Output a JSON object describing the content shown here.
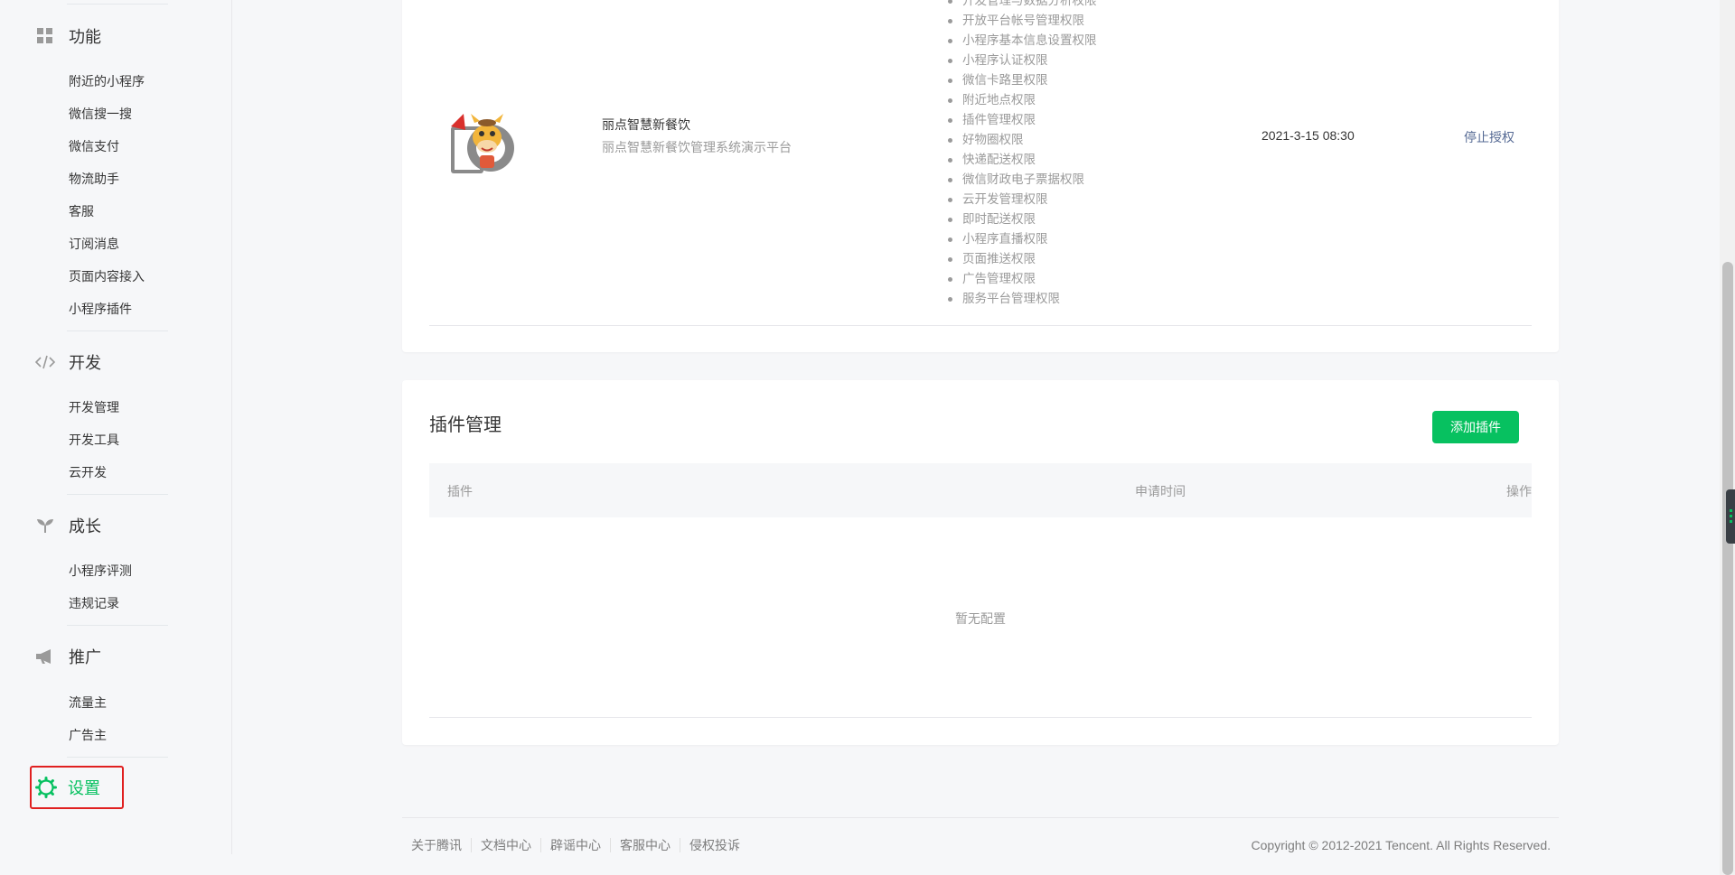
{
  "sidebar": {
    "features": {
      "title": "功能",
      "icon": "grid-icon",
      "items": [
        "附近的小程序",
        "微信搜一搜",
        "微信支付",
        "物流助手",
        "客服",
        "订阅消息",
        "页面内容接入",
        "小程序插件"
      ]
    },
    "develop": {
      "title": "开发",
      "icon": "code-icon",
      "items": [
        "开发管理",
        "开发工具",
        "云开发"
      ]
    },
    "growth": {
      "title": "成长",
      "icon": "sprout-icon",
      "items": [
        "小程序评测",
        "违规记录"
      ]
    },
    "promote": {
      "title": "推广",
      "icon": "megaphone-icon",
      "items": [
        "流量主",
        "广告主"
      ]
    },
    "settings": {
      "title": "设置",
      "icon": "gear-icon"
    }
  },
  "authorized_app": {
    "name": "丽点智慧新餐饮",
    "description": "丽点智慧新餐饮管理系统演示平台",
    "permissions": [
      "开发管理与数据分析权限",
      "开放平台帐号管理权限",
      "小程序基本信息设置权限",
      "小程序认证权限",
      "微信卡路里权限",
      "附近地点权限",
      "插件管理权限",
      "好物圈权限",
      "快递配送权限",
      "微信财政电子票据权限",
      "云开发管理权限",
      "即时配送权限",
      "小程序直播权限",
      "页面推送权限",
      "广告管理权限",
      "服务平台管理权限"
    ],
    "auth_time": "2021-3-15 08:30",
    "stop_label": "停止授权"
  },
  "plugin_panel": {
    "title": "插件管理",
    "add_button": "添加插件",
    "columns": {
      "plugin": "插件",
      "apply_time": "申请时间",
      "action": "操作"
    },
    "empty_text": "暂无配置"
  },
  "footer": {
    "links": [
      "关于腾讯",
      "文档中心",
      "辟谣中心",
      "客服中心",
      "侵权投诉"
    ],
    "copyright": "Copyright © 2012-2021 Tencent. All Rights Reserved."
  },
  "colors": {
    "accent": "#07c160",
    "link": "#576b95",
    "highlight_box": "#e02020"
  }
}
